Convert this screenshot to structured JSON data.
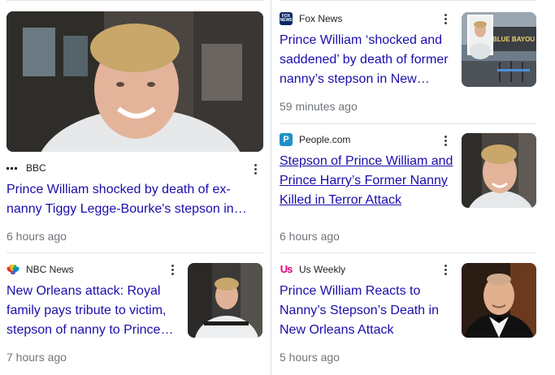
{
  "articles": [
    {
      "source": "BBC",
      "logo_icon": "bbc-logo-icon",
      "headline": "Prince William shocked by death of ex-nanny Tiggy Legge-Bourke's stepson in Ne…",
      "time": "6 hours ago"
    },
    {
      "source": "Fox News",
      "logo_icon": "fox-news-logo-icon",
      "logo_text": "FOX NEWS",
      "headline": "Prince William ‘shocked and saddened’ by death of former nanny’s stepson in New…",
      "time": "59 minutes ago",
      "thumb_sign": "BLUE BAYOU"
    },
    {
      "source": "People.com",
      "logo_icon": "people-logo-icon",
      "logo_text": "P",
      "headline": "Stepson of Prince William and Prince Harry’s Former Nanny Killed in Terror Attack",
      "time": "6 hours ago"
    },
    {
      "source": "NBC News",
      "logo_icon": "nbc-peacock-logo-icon",
      "headline": "New Orleans attack: Royal family pays tribute to victim, stepson of nanny to Prince…",
      "time": "7 hours ago"
    },
    {
      "source": "Us Weekly",
      "logo_icon": "us-weekly-logo-icon",
      "logo_text": "Us",
      "headline": "Prince William Reacts to Nanny’s Stepson’s Death in New Orleans Attack",
      "time": "5 hours ago"
    }
  ],
  "colors": {
    "link": "#1a0dab",
    "meta": "#70757a",
    "people_blue": "#1e90c8",
    "us_weekly_pink": "#e4007c",
    "fox_navy": "#0a2a66"
  }
}
